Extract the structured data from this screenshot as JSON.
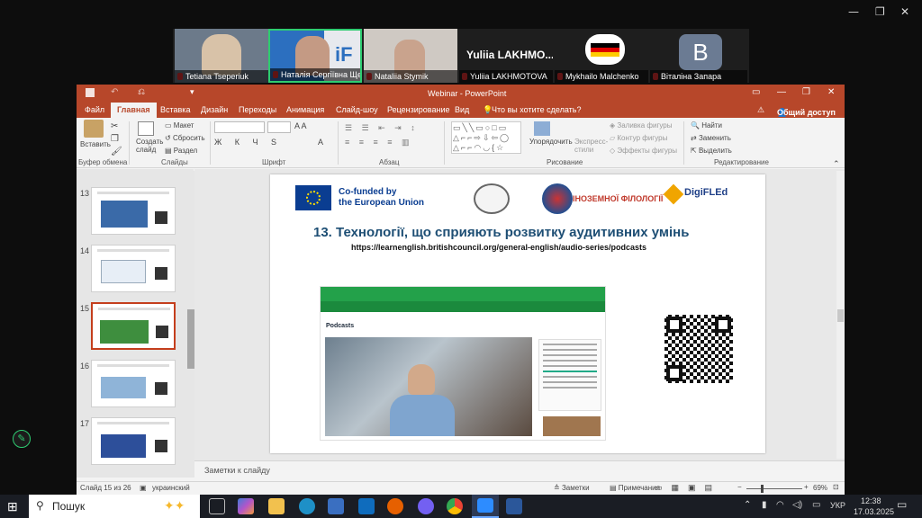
{
  "participants": [
    {
      "name": "Tetiana Tseperiuk"
    },
    {
      "name": "Наталія Сергіївна Щерба"
    },
    {
      "name": "Nataliia Stymik"
    },
    {
      "name": "Yuliia LAKHMOTOVA",
      "display": "Yuliia  LAKHMO..."
    },
    {
      "name": "Mykhailo Malchenko"
    },
    {
      "name": "Віталіна Запара",
      "initial": "B"
    }
  ],
  "ppt": {
    "window_title": "Webinar - PowerPoint",
    "tabs": [
      "Файл",
      "Главная",
      "Вставка",
      "Дизайн",
      "Переходы",
      "Анимация",
      "Слайд-шоу",
      "Рецензирование",
      "Вид"
    ],
    "tell_me": "Что вы хотите сделать?",
    "share": "Общий доступ",
    "ribbon": {
      "paste": "Вставить",
      "clipboard_group": "Буфер обмена",
      "layout": "Макет",
      "reset": "Сбросить",
      "section": "Раздел",
      "new_slide": "Создать слайд",
      "slides_group": "Слайды",
      "font_group": "Шрифт",
      "paragraph_group": "Абзац",
      "arrange": "Упорядочить",
      "quick_styles": "Экспресс-стили",
      "shape_fill": "Заливка фигуры",
      "shape_outline": "Контур фигуры",
      "shape_effects": "Эффекты фигуры",
      "drawing_group": "Рисование",
      "find": "Найти",
      "replace": "Заменить",
      "select": "Выделить",
      "editing_group": "Редактирование"
    },
    "thumbnails": [
      {
        "num": "13"
      },
      {
        "num": "14"
      },
      {
        "num": "15"
      },
      {
        "num": "16"
      },
      {
        "num": "17"
      }
    ],
    "slide": {
      "logo_eu_1": "Co-funded by",
      "logo_eu_2": "the European Union",
      "logo_inst": "ІНОЗЕМНОЇ ФІЛОЛОГІЇ",
      "logo_digi": "DigiFLEd",
      "title_num": "13.",
      "title": "Технології, що сприяють розвитку аудитивних умінь",
      "url": "https://learnenglish.britishcouncil.org/general-english/audio-series/podcasts",
      "embed_heading": "Podcasts"
    },
    "notes_placeholder": "Заметки к слайду",
    "status": {
      "slide_counter": "Слайд 15 из 26",
      "language": "украинский",
      "notes": "Заметки",
      "comments": "Примечания",
      "zoom": "69%"
    }
  },
  "taskbar": {
    "search": "Пошук",
    "lang": "УКР",
    "time": "12:38",
    "date": "17.03.2025"
  }
}
